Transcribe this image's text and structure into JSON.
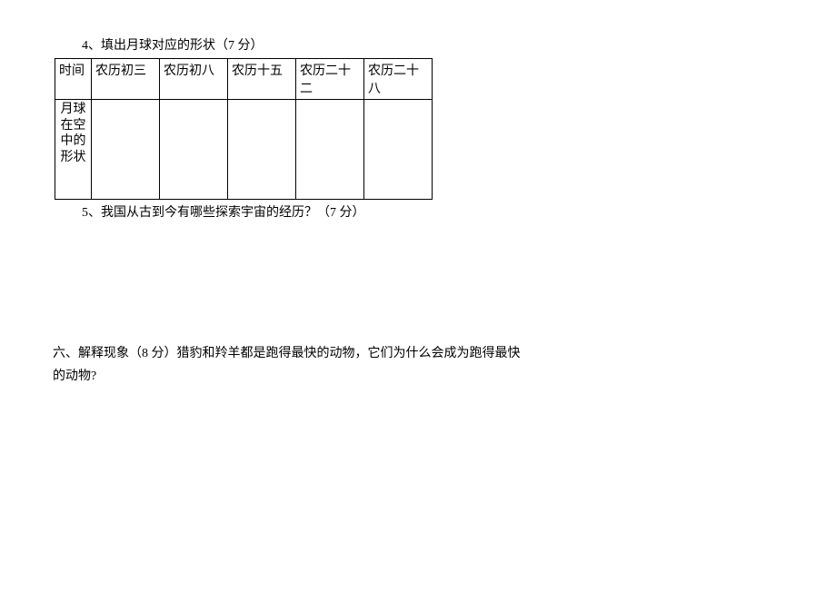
{
  "q4": {
    "prompt": "4、填出月球对应的形状（7 分）"
  },
  "table": {
    "row_label_time": "时间",
    "row_label_shape": "月球在空中的形状",
    "headers": [
      "农历初三",
      "农历初八",
      "农历十五",
      "农历二十二",
      "农历二十八"
    ]
  },
  "q5": {
    "prompt": "5、我国从古到今有哪些探索宇宙的经历？（7 分）"
  },
  "q6": {
    "line1": "六、解释现象（8 分）猎豹和羚羊都是跑得最快的动物，它们为什么会成为跑得最快",
    "line2": "的动物?"
  }
}
